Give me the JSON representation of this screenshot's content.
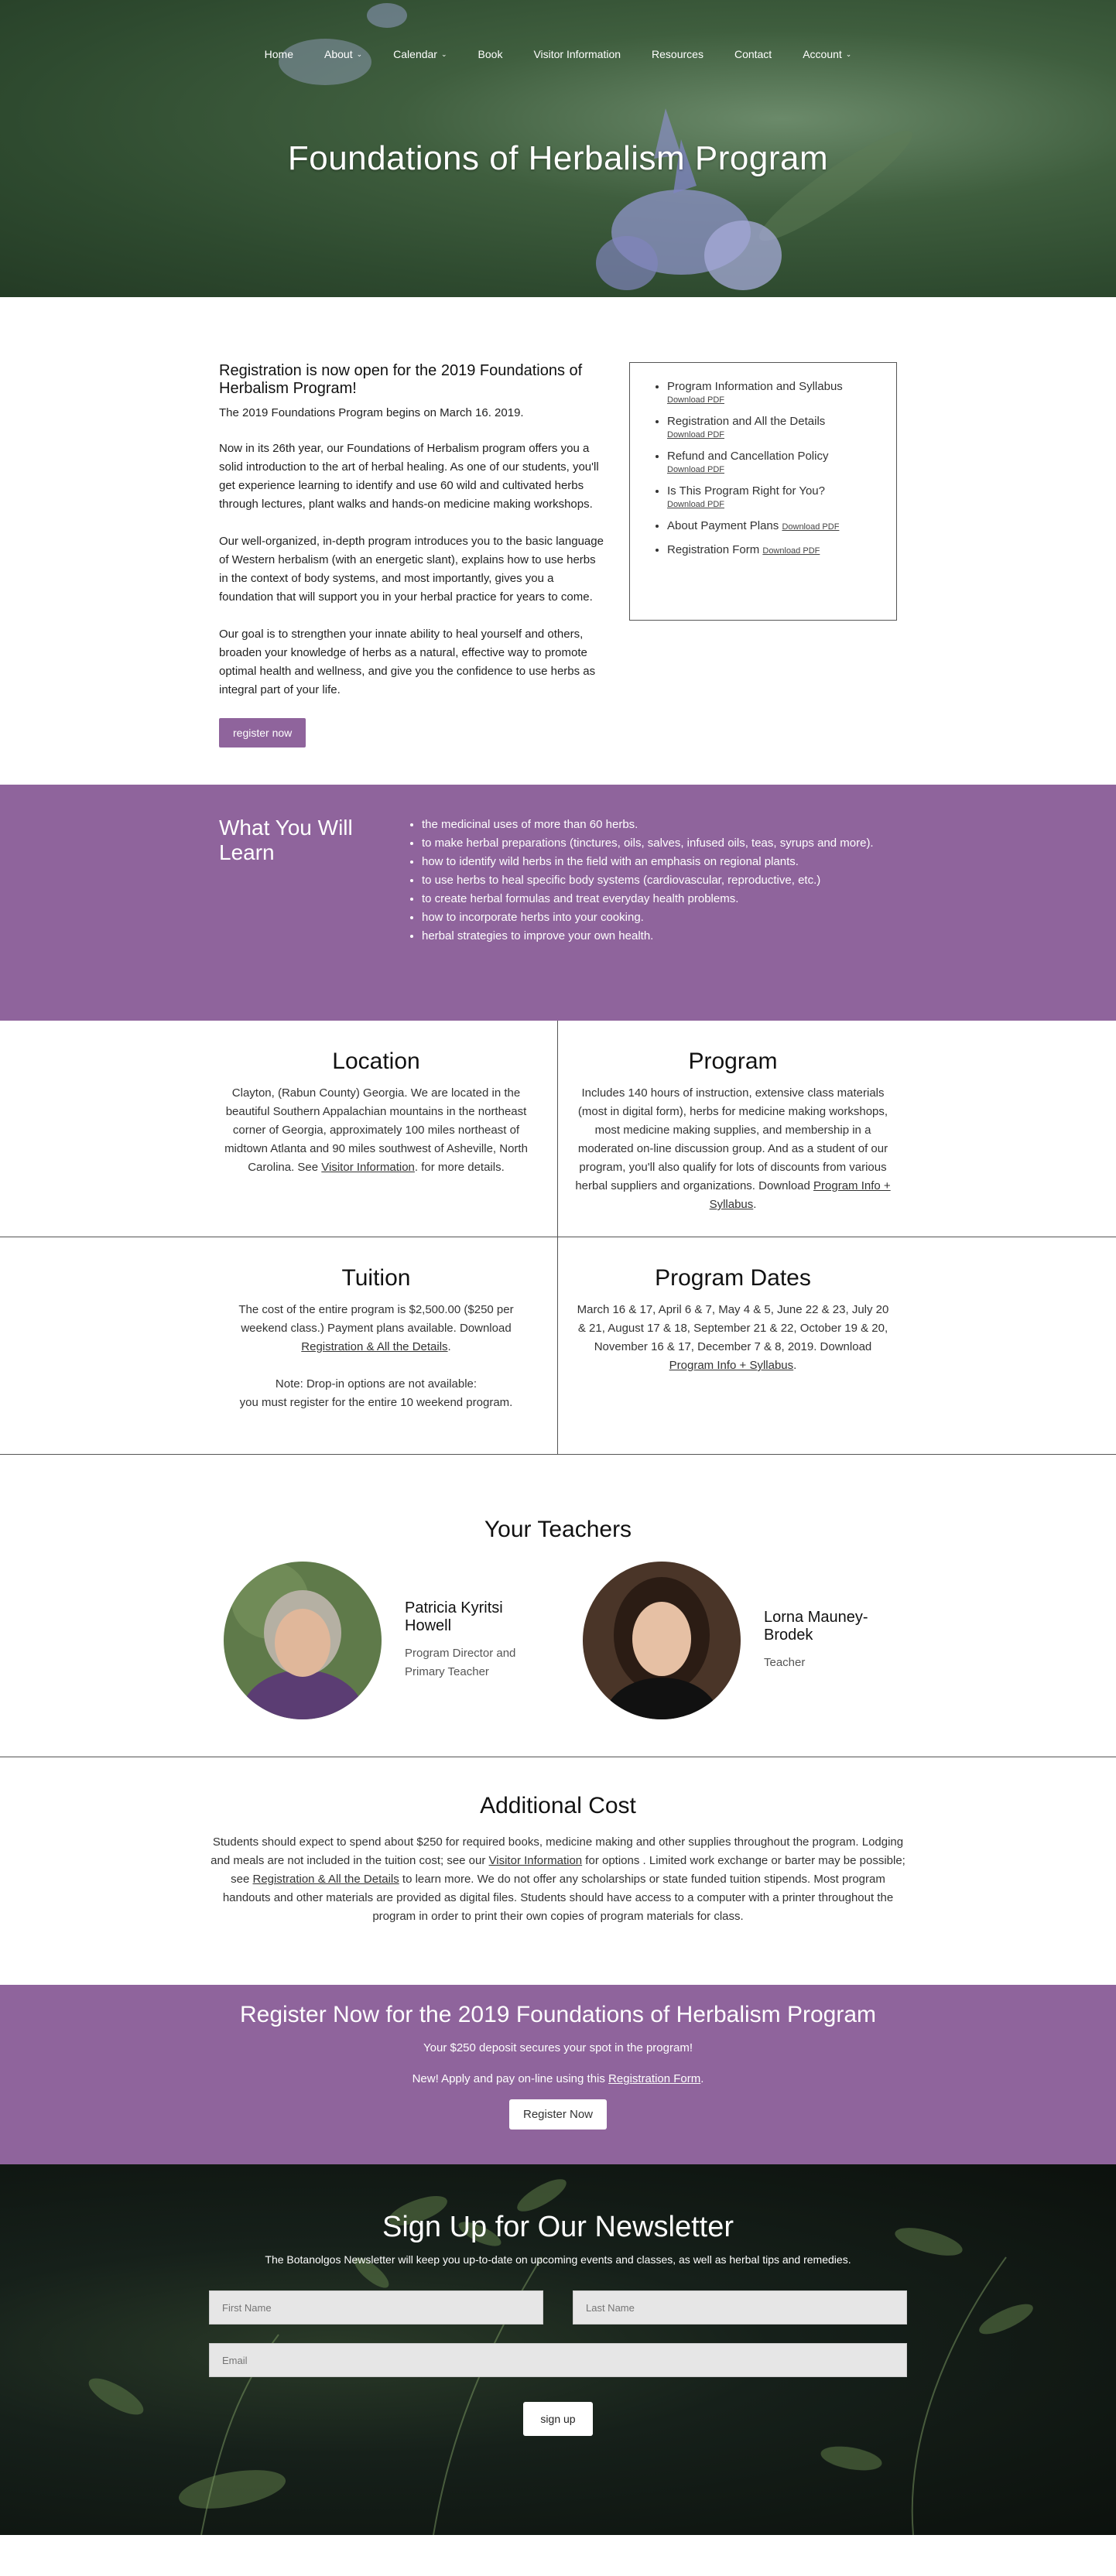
{
  "nav": [
    {
      "label": "Home",
      "has_dropdown": false
    },
    {
      "label": "About",
      "has_dropdown": true
    },
    {
      "label": "Calendar",
      "has_dropdown": true
    },
    {
      "label": "Book",
      "has_dropdown": false
    },
    {
      "label": "Visitor Information",
      "has_dropdown": false
    },
    {
      "label": "Resources",
      "has_dropdown": false
    },
    {
      "label": "Contact",
      "has_dropdown": false
    },
    {
      "label": "Account",
      "has_dropdown": true
    }
  ],
  "hero": {
    "title": "Foundations of Herbalism Program"
  },
  "intro": {
    "heading": "Registration is now open for the 2019 Foundations of Herbalism Program!",
    "begins": "The 2019 Foundations Program begins on March 16. 2019.",
    "p1": "Now in its 26th year, our Foundations of Herbalism program offers you a solid introduction to the art of herbal healing. As one of our students, you'll get  experience learning to identify and use 60 wild and cultivated herbs through lectures, plant walks and hands-on medicine making workshops.",
    "p2": "Our well-organized, in-depth program introduces you to the basic language of Western herbalism (with an energetic slant), explains how to use herbs in the context of body systems, and most importantly, gives you a foundation that will support you in your herbal practice for years to come.",
    "p3": "Our goal is to strengthen your innate ability to heal yourself and others, broaden your knowledge of herbs as a natural, effective way to promote optimal health and wellness, and give you the confidence to use herbs as integral part of your life.",
    "button": "register now"
  },
  "downloads": [
    {
      "label": "Program Information and Syllabus",
      "link": "Download PDF",
      "inline": false
    },
    {
      "label": "Registration and All the Details",
      "link": "Download PDF",
      "inline": false
    },
    {
      "label": "Refund and Cancellation Policy",
      "link": "Download PDF",
      "inline": false
    },
    {
      "label": "Is This Program Right for You?",
      "link": "Download PDF",
      "inline": false
    },
    {
      "label": "About Payment Plans",
      "link": "Download PDF",
      "inline": true
    },
    {
      "label": "Registration Form",
      "link": "Download PDF",
      "inline": true
    }
  ],
  "learn": {
    "title": "What You Will Learn",
    "items": [
      "the medicinal uses of more than 60 herbs.",
      "to make herbal preparations (tinctures, oils, salves, infused oils, teas, syrups and more).",
      "how to identify wild herbs in the field with an emphasis on regional plants.",
      "to use herbs to heal specific body systems (cardiovascular, reproductive, etc.)",
      "to create herbal formulas and treat everyday health problems.",
      "how to incorporate herbs into your cooking.",
      "herbal strategies to improve your own health."
    ]
  },
  "location": {
    "title": "Location",
    "text": "Clayton, (Rabun County) Georgia. We are located in the beautiful Southern Appalachian mountains in the northeast corner of Georgia, approximately 100 miles northeast of midtown Atlanta and 90 miles southwest of Asheville, North Carolina. See ",
    "link": "Visitor Information",
    "after": ". for more details."
  },
  "program": {
    "title": "Program",
    "text": "Includes 140 hours of instruction, extensive class materials (most in digital form), herbs for medicine making workshops, most medicine making supplies, and membership in a moderated on-line discussion group. And as a student of our program, you'll also qualify for lots of discounts from various herbal suppliers and organizations. Download ",
    "link": "Program Info + Syllabus",
    "after": "."
  },
  "tuition": {
    "title": "Tuition",
    "line1": "The cost of the entire program is $2,500.00 ($250 per weekend class.) Payment plans available. Download ",
    "link": "Registration & All the Details",
    "after": ".",
    "note1": "Note: Drop-in options are not available:",
    "note2": "you must register for the entire 10 weekend program."
  },
  "dates": {
    "title": "Program Dates",
    "text": "March 16 & 17, April 6 & 7, May 4 & 5, June 22 & 23, July 20 & 21, August 17 & 18, September 21 & 22, October 19 & 20, November 16 & 17, December 7 & 8, 2019. Download ",
    "link": "Program Info + Syllabus",
    "after": "."
  },
  "teachers": {
    "title": "Your Teachers",
    "people": [
      {
        "name": "Patricia Kyritsi Howell",
        "role": "Program Director and Primary Teacher"
      },
      {
        "name": "Lorna Mauney-Brodek",
        "role": "Teacher"
      }
    ]
  },
  "cost": {
    "title": "Additional Cost",
    "t1": "Students should expect to spend about $250 for required books, medicine making and other supplies throughout the program. Lodging and meals are not included in the tuition cost; see our ",
    "link1": "Visitor Information",
    "t2": " for options . Limited work exchange or barter may be possible; see ",
    "link2": "Registration & All the Details",
    "t3": " to learn more.  We do not offer any scholarships or state funded tuition stipends. Most program handouts and other materials are provided as digital files. Students should have access to a computer with a printer throughout the program in order to print their own copies of program materials for class."
  },
  "register": {
    "title": "Register Now for the 2019 Foundations of Herbalism Program",
    "deposit": "Your $250 deposit secures your spot in the program!",
    "apply": "New! Apply and pay on-line using this ",
    "link": "Registration Form",
    "after": ".",
    "button": "Register Now"
  },
  "newsletter": {
    "title": "Sign Up for Our Newsletter",
    "subtitle": "The Botanolgos Newsletter will keep you up-to-date on upcoming events and classes, as well as herbal tips and remedies.",
    "first_name_placeholder": "First Name",
    "last_name_placeholder": "Last Name",
    "email_placeholder": "Email",
    "button": "sign up"
  },
  "colors": {
    "accent": "#8f649c",
    "hero_green": "#3f5e3e"
  }
}
